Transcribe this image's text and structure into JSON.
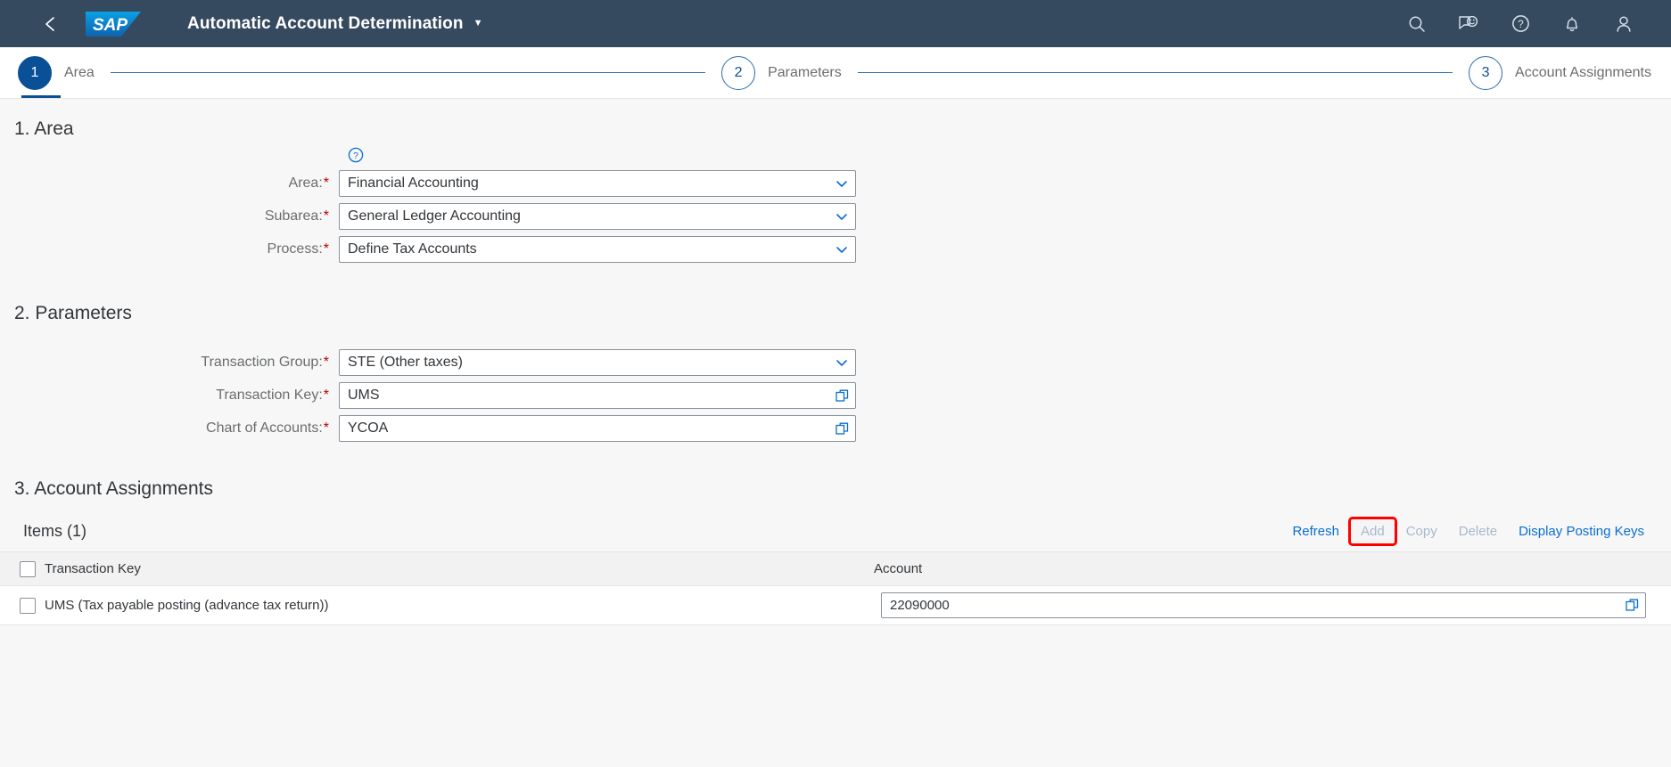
{
  "header": {
    "back_icon": "back-chevron-icon",
    "logo_text": "SAP",
    "title": "Automatic Account Determination",
    "title_caret": "▼",
    "icons": [
      {
        "name": "search-icon"
      },
      {
        "name": "feedback-icon"
      },
      {
        "name": "help-icon"
      },
      {
        "name": "notifications-bell-icon"
      },
      {
        "name": "user-profile-icon"
      }
    ]
  },
  "wizard": {
    "steps": [
      {
        "number": "1",
        "label": "Area",
        "state": "active"
      },
      {
        "number": "2",
        "label": "Parameters",
        "state": "inactive"
      },
      {
        "number": "3",
        "label": "Account Assignments",
        "state": "inactive"
      }
    ]
  },
  "sections": {
    "area": {
      "title": "1. Area",
      "help_icon": "help-circle-icon",
      "fields": [
        {
          "label": "Area:",
          "required": "*",
          "value": "Financial Accounting",
          "icon": "chevron-down-icon"
        },
        {
          "label": "Subarea:",
          "required": "*",
          "value": "General Ledger Accounting",
          "icon": "chevron-down-icon"
        },
        {
          "label": "Process:",
          "required": "*",
          "value": "Define Tax Accounts",
          "icon": "chevron-down-icon"
        }
      ]
    },
    "parameters": {
      "title": "2. Parameters",
      "fields": [
        {
          "label": "Transaction Group:",
          "required": "*",
          "value": "STE (Other taxes)",
          "icon": "chevron-down-icon"
        },
        {
          "label": "Transaction Key:",
          "required": "*",
          "value": "UMS",
          "icon": "value-help-icon"
        },
        {
          "label": "Chart of Accounts:",
          "required": "*",
          "value": "YCOA",
          "icon": "value-help-icon"
        }
      ]
    },
    "account_assignments": {
      "title": "3. Account Assignments",
      "items_title": "Items (1)",
      "toolbar": [
        {
          "label": "Refresh",
          "state": "enabled",
          "highlighted": false
        },
        {
          "label": "Add",
          "state": "disabled",
          "highlighted": true
        },
        {
          "label": "Copy",
          "state": "disabled",
          "highlighted": false
        },
        {
          "label": "Delete",
          "state": "disabled",
          "highlighted": false
        },
        {
          "label": "Display Posting Keys",
          "state": "enabled",
          "highlighted": false
        }
      ],
      "columns": [
        {
          "label": "Transaction Key"
        },
        {
          "label": "Account"
        }
      ],
      "rows": [
        {
          "transaction_key": "UMS (Tax payable posting (advance tax return))",
          "account": "22090000",
          "account_icon": "value-help-icon"
        }
      ]
    }
  },
  "colors": {
    "shell_bg": "#354a5f",
    "accent_blue": "#0a6ed1",
    "step_active": "#0a5096",
    "required_red": "#bb0000",
    "highlight_red": "#ff0000"
  }
}
